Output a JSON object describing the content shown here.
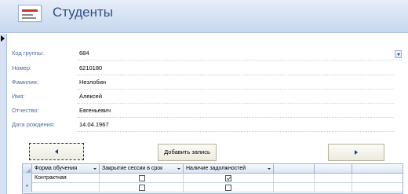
{
  "header": {
    "title": "Студенты",
    "icon": "form-icon"
  },
  "fields": [
    {
      "label": "Код группы:",
      "value": "684"
    },
    {
      "label": "Номер:",
      "value": "6210180"
    },
    {
      "label": "Фамилия:",
      "value": "Незлобин"
    },
    {
      "label": "Имя:",
      "value": "Алексей"
    },
    {
      "label": "Отчество:",
      "value": "Евгеньевич"
    },
    {
      "label": "Дата рождения:",
      "value": "14.04.1967"
    }
  ],
  "buttons": {
    "prev_icon": "triangle-left",
    "add_label": "Добавить запись",
    "next_icon": "triangle-right"
  },
  "subform": {
    "columns": [
      "Форма обучения",
      "Закрытие сессии в срок",
      "Наличие задолжностей"
    ],
    "rows": [
      {
        "form": "Контрактная",
        "closed_on_time": false,
        "has_debts": true
      }
    ],
    "new_row_marker": "*"
  }
}
